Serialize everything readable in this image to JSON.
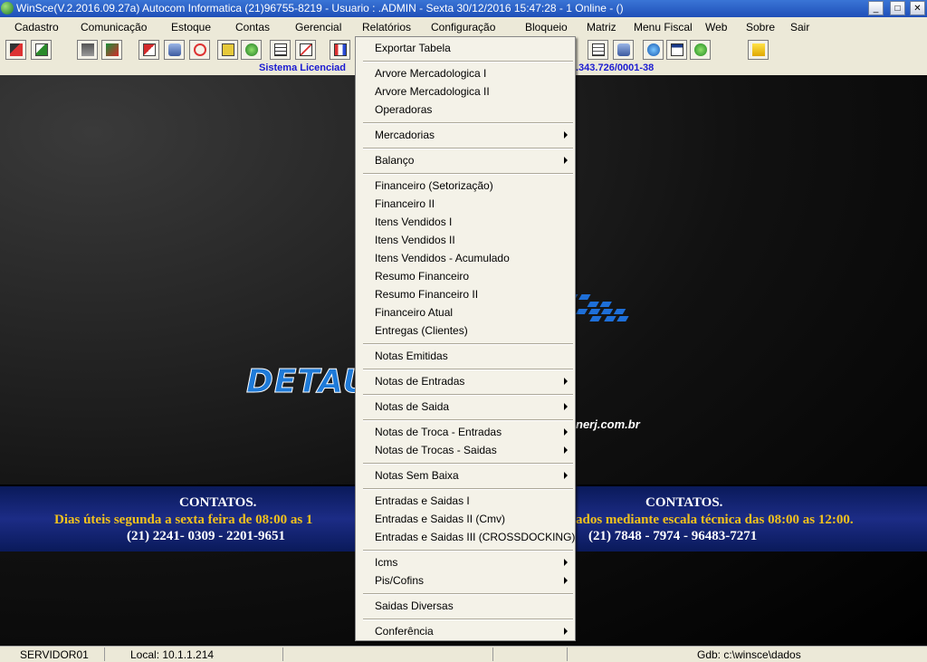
{
  "window": {
    "title": "WinSce(V.2.2016.09.27a) Autocom Informatica (21)96755-8219  -  Usuario : .ADMIN - Sexta 30/12/2016 15:47:28 - 1 Online - ()",
    "minimize": "_",
    "maximize": "□",
    "close": "✕"
  },
  "menubar": {
    "items": [
      "Cadastro",
      "Comunicação",
      "Estoque",
      "Contas",
      "Gerencial",
      "Relatórios",
      "Configuração",
      "Bloqueio",
      "Matriz",
      "Menu Fiscal",
      "Web",
      "Sobre",
      "Sair"
    ]
  },
  "license": {
    "left": "Sistema Licenciad",
    "right": ".343.726/0001-38"
  },
  "dropdown": {
    "items": [
      {
        "label": "Exportar Tabela",
        "submenu": false
      },
      {
        "label": "Arvore Mercadologica I",
        "submenu": false
      },
      {
        "label": "Arvore Mercadologica II",
        "submenu": false
      },
      {
        "label": "Operadoras",
        "submenu": false
      },
      {
        "label": "Mercadorias",
        "submenu": true
      },
      {
        "label": "Balanço",
        "submenu": true
      },
      {
        "label": "Financeiro (Setorização)",
        "submenu": false
      },
      {
        "label": "Financeiro II",
        "submenu": false
      },
      {
        "label": "Itens Vendidos I",
        "submenu": false
      },
      {
        "label": "Itens Vendidos II",
        "submenu": false
      },
      {
        "label": "Itens Vendidos - Acumulado",
        "submenu": false
      },
      {
        "label": "Resumo Financeiro",
        "submenu": false
      },
      {
        "label": "Resumo Financeiro II",
        "submenu": false
      },
      {
        "label": "Financeiro Atual",
        "submenu": false
      },
      {
        "label": "Entregas (Clientes)",
        "submenu": false
      },
      {
        "label": "Notas Emitidas",
        "submenu": false
      },
      {
        "label": "Notas de Entradas",
        "submenu": true
      },
      {
        "label": "Notas de Saida",
        "submenu": true
      },
      {
        "label": "Notas de Troca - Entradas",
        "submenu": true
      },
      {
        "label": "Notas de Trocas - Saidas",
        "submenu": true
      },
      {
        "label": "Notas Sem  Baixa",
        "submenu": true
      },
      {
        "label": "Entradas e Saidas I",
        "submenu": false
      },
      {
        "label": "Entradas e Saidas II (Cmv)",
        "submenu": false
      },
      {
        "label": "Entradas e Saidas III (CROSSDOCKING)",
        "submenu": false
      },
      {
        "label": "Icms",
        "submenu": true
      },
      {
        "label": "Pis/Cofins",
        "submenu": true
      },
      {
        "label": "Saidas Diversas",
        "submenu": false
      },
      {
        "label": "Conferência",
        "submenu": true
      }
    ]
  },
  "background": {
    "brand": "DETAU",
    "url": "nerj.com.br",
    "contacts_left_title": "CONTATOS.",
    "contacts_left_hours": "Dias úteis segunda a sexta feira de 08:00 as 1",
    "contacts_left_phones": "(21)  2241- 0309 - 2201-9651",
    "contacts_right_title": "CONTATOS.",
    "contacts_right_hours": "ados mediante escala técnica das 08:00 as 12:00.",
    "contacts_right_phones": "(21)  7848 - 7974 - 96483-7271"
  },
  "statusbar": {
    "server": "SERVIDOR01",
    "local": "Local: 10.1.1.214",
    "gdb": "Gdb: c:\\winsce\\dados"
  },
  "colors": {
    "menu_bg": "#ece9d8",
    "titlebar": "#2a5fc6",
    "license_text": "#1b1bd1",
    "contacts_band": "#1c2c86",
    "contacts_yellow": "#f2c21c"
  }
}
